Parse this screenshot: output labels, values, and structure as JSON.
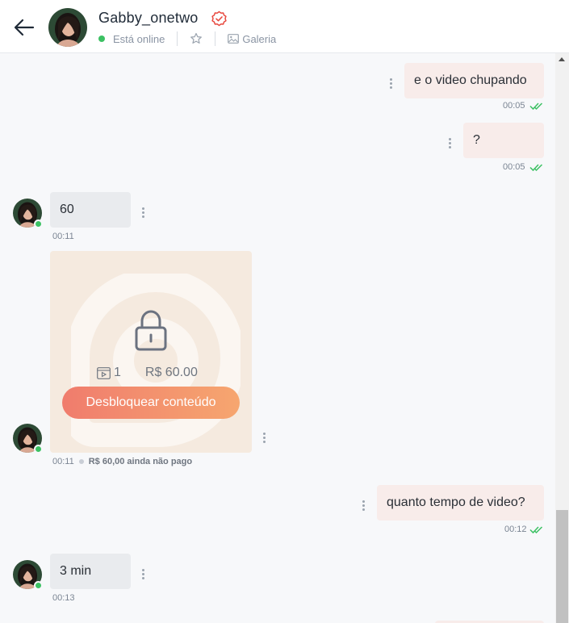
{
  "header": {
    "username": "Gabby_onetwo",
    "status": "Está online",
    "gallery_label": "Galeria"
  },
  "colors": {
    "accent": "#f07c6d",
    "online": "#3cc163",
    "read_check": "#3cc163",
    "bubble_out": "#f8ecea",
    "bubble_in": "#e9ebee"
  },
  "messages": [
    {
      "direction": "out",
      "text": "e o video chupando",
      "time": "00:05",
      "read": true
    },
    {
      "direction": "out",
      "text": "?",
      "time": "00:05",
      "read": true
    },
    {
      "direction": "in",
      "text": "60",
      "time": "00:11"
    },
    {
      "direction": "in",
      "type": "locked-media",
      "media_count": "1",
      "price": "R$ 60.00",
      "unlock_label": "Desbloquear conteúdo",
      "time": "00:11",
      "payment_status": "R$ 60,00 ainda não pago"
    },
    {
      "direction": "out",
      "text": "quanto tempo de video?",
      "time": "00:12",
      "read": true
    },
    {
      "direction": "in",
      "text": "3 min",
      "time": "00:13"
    }
  ],
  "icons": {
    "back": "arrow-left-icon",
    "verified": "verified-badge-icon",
    "favorite": "star-icon",
    "gallery": "image-icon",
    "options": "kebab-icon",
    "lock": "lock-icon",
    "media": "video-icon"
  }
}
